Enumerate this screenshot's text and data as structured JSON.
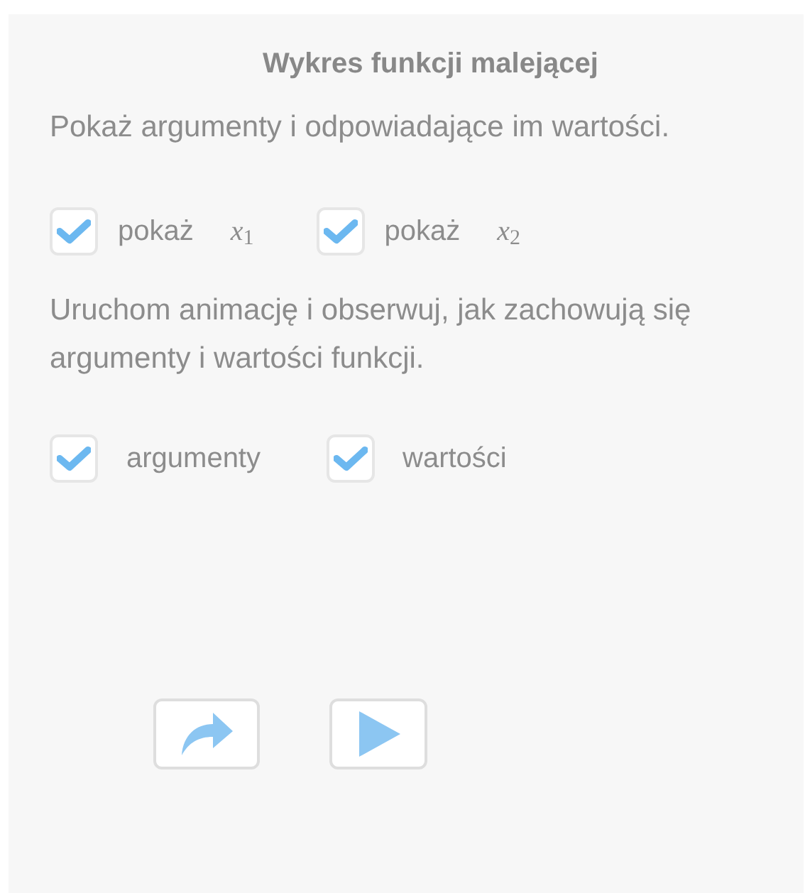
{
  "title": "Wykres funkcji malejącej",
  "instruction_1": "Pokaż argumenty i odpowiadające im wartości.",
  "show_options": [
    {
      "label": "pokaż",
      "math": "*x*$_{1}$",
      "checked": true
    },
    {
      "label": "pokaż",
      "math": "*x*$_{2}$",
      "checked": true
    }
  ],
  "instruction_2": "Uruchom animację i obserwuj, jak zachowują się argumenty i wartości funkcji.",
  "animation_options": [
    {
      "label": "argumenty",
      "checked": true
    },
    {
      "label": "wartości",
      "checked": true
    }
  ],
  "buttons": [
    {
      "kind": "redo"
    },
    {
      "kind": "play"
    }
  ]
}
